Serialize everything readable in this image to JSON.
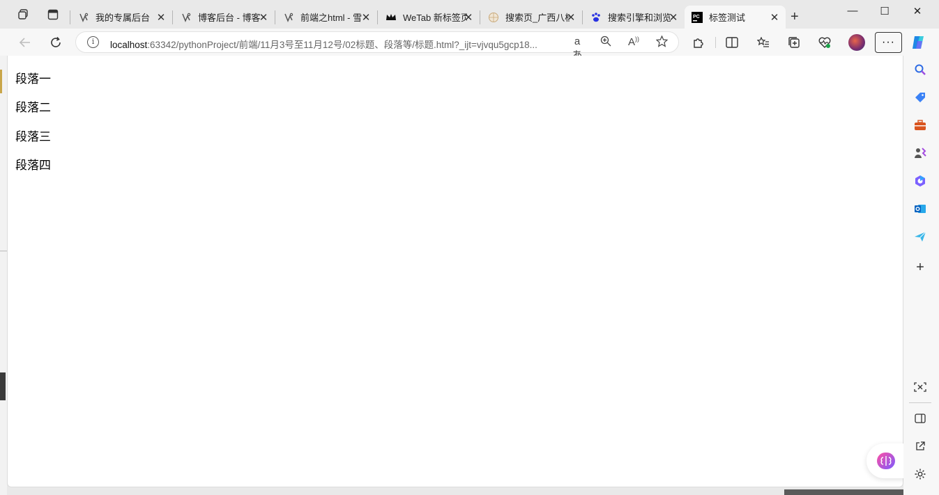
{
  "window": {
    "tabs": [
      {
        "label": "我的专属后台",
        "favicon": "blog-icon",
        "active": false
      },
      {
        "label": "博客后台 - 博客",
        "favicon": "blog-icon",
        "active": false
      },
      {
        "label": "前端之html - 雪",
        "favicon": "blog-icon",
        "active": false
      },
      {
        "label": "WeTab 新标签页",
        "favicon": "crown-icon",
        "active": false
      },
      {
        "label": "搜索页_广西八桂",
        "favicon": "globe-icon",
        "active": false
      },
      {
        "label": "搜索引擎和浏览",
        "favicon": "paw-icon",
        "active": false
      },
      {
        "label": "标签测试",
        "favicon": "pycharm-icon",
        "active": true
      }
    ],
    "controls": {
      "minimize": "—",
      "maximize": "☐",
      "close": "✕"
    }
  },
  "address_bar": {
    "host": "localhost",
    "path": ":63342/pythonProject/前端/11月3号至11月12号/02标题、段落等/标题.html?_ijt=vjvqu5gcp18..."
  },
  "content": {
    "paragraphs": [
      "段落一",
      "段落二",
      "段落三",
      "段落四"
    ]
  },
  "colors": {
    "accent": "#1a73e8",
    "page_bg": "#ffffff",
    "chrome_bg": "#f7f7f7"
  }
}
